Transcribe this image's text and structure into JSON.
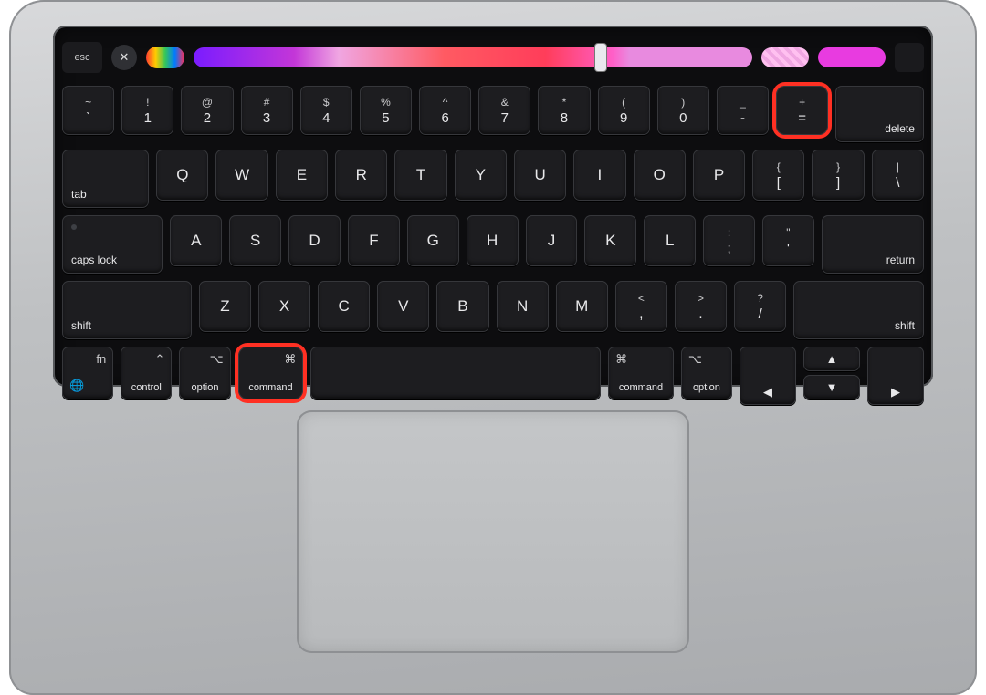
{
  "touchbar": {
    "esc": "esc",
    "close": "✕"
  },
  "row1": {
    "keys": [
      {
        "sec": "~",
        "pri": "`"
      },
      {
        "sec": "!",
        "pri": "1"
      },
      {
        "sec": "@",
        "pri": "2"
      },
      {
        "sec": "#",
        "pri": "3"
      },
      {
        "sec": "$",
        "pri": "4"
      },
      {
        "sec": "%",
        "pri": "5"
      },
      {
        "sec": "^",
        "pri": "6"
      },
      {
        "sec": "&",
        "pri": "7"
      },
      {
        "sec": "*",
        "pri": "8"
      },
      {
        "sec": "(",
        "pri": "9"
      },
      {
        "sec": ")",
        "pri": "0"
      },
      {
        "sec": "_",
        "pri": "-"
      },
      {
        "sec": "+",
        "pri": "="
      }
    ],
    "delete": "delete"
  },
  "row2": {
    "tab": "tab",
    "keys": [
      "Q",
      "W",
      "E",
      "R",
      "T",
      "Y",
      "U",
      "I",
      "O",
      "P"
    ],
    "br1": {
      "sec": "{",
      "pri": "["
    },
    "br2": {
      "sec": "}",
      "pri": "]"
    },
    "bs": {
      "sec": "|",
      "pri": "\\"
    }
  },
  "row3": {
    "caps": "caps lock",
    "keys": [
      "A",
      "S",
      "D",
      "F",
      "G",
      "H",
      "J",
      "K",
      "L"
    ],
    "sc": {
      "sec": ":",
      "pri": ";"
    },
    "qt": {
      "sec": "\"",
      "pri": "'"
    },
    "return": "return"
  },
  "row4": {
    "shift": "shift",
    "keys": [
      "Z",
      "X",
      "C",
      "V",
      "B",
      "N",
      "M"
    ],
    "cm": {
      "sec": "<",
      "pri": ","
    },
    "pd": {
      "sec": ">",
      "pri": "."
    },
    "sl": {
      "sec": "?",
      "pri": "/"
    }
  },
  "row5": {
    "fn": "fn",
    "globe": "🌐",
    "ctrl": "control",
    "ctrl_sym": "⌃",
    "opt": "option",
    "opt_sym": "⌥",
    "cmd": "command",
    "cmd_sym": "⌘",
    "arrows": {
      "up": "▲",
      "down": "▼",
      "left": "◀",
      "right": "▶"
    }
  },
  "highlights": {
    "plus_equals": true,
    "left_command": true
  }
}
